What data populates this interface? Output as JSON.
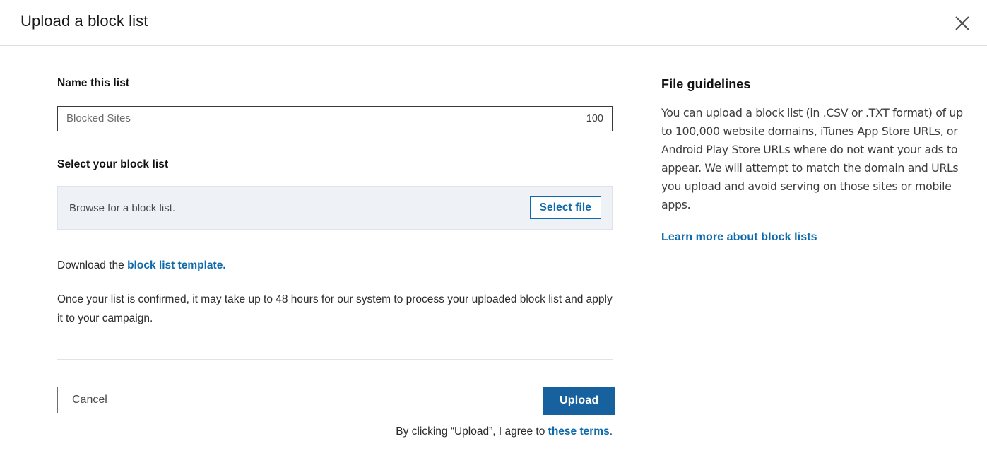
{
  "header": {
    "title": "Upload a block list",
    "close_icon": "close-icon"
  },
  "form": {
    "name_label": "Name this list",
    "name_value": "",
    "name_placeholder": "Blocked Sites",
    "char_counter": "100",
    "blocklist_label": "Select your block list",
    "file_hint": "Browse for a block list.",
    "select_file_label": "Select file",
    "download_prefix": "Download the ",
    "download_link": "block list template.",
    "processing_note": "Once your list is confirmed, it may take up to 48 hours for our system to process your uploaded block list and apply it to your campaign.",
    "cancel_label": "Cancel",
    "upload_label": "Upload",
    "terms_prefix": "By clicking “Upload”, I agree to ",
    "terms_link": "these terms",
    "terms_suffix": "."
  },
  "guidelines": {
    "title": "File guidelines",
    "body": "You can upload a block list (in .CSV or .TXT format) of up to 100,000 website domains, iTunes App Store URLs, or Android Play Store URLs where do not want your ads to appear. We will attempt to match the domain and URLs you upload and avoid serving on those sites or mobile apps.",
    "learn_more": "Learn more about block lists"
  },
  "colors": {
    "accent_blue": "#0e6aab",
    "primary_button": "#17619e",
    "file_box_bg": "#eef2f6",
    "divider": "#e3e3e3"
  }
}
